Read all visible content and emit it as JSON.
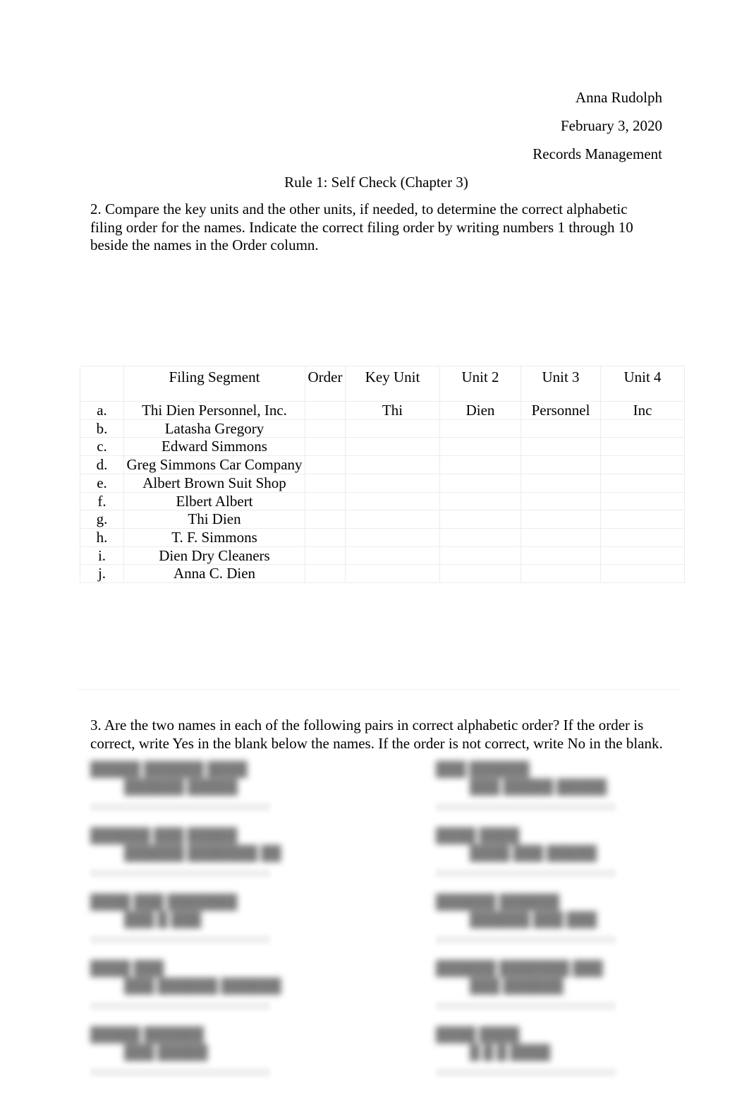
{
  "document": {
    "header_lines": [
      "Anna Rudolph",
      "February 3, 2020",
      "Records Management"
    ],
    "title": "Rule 1: Self Check (Chapter 3)",
    "question_2": "2. Compare the key units and the other units, if needed, to determine the correct alphabetic filing order for the names. Indicate the correct filing order by writing numbers 1 through 10 beside the names in the Order column.",
    "question_3": "3. Are the two names in each of the following pairs in correct alphabetic order? If the order is correct, write Yes in the blank below the names. If the order is not correct, write No in the blank."
  },
  "filing_table": {
    "headers": {
      "letter": "",
      "filing_segment": "Filing Segment",
      "order": "Order",
      "key_unit": "Key Unit",
      "unit_2": "Unit 2",
      "unit_3": "Unit 3",
      "unit_4": "Unit 4"
    },
    "rows": [
      {
        "letter": "a.",
        "filing_segment": "Thi Dien Personnel, Inc.",
        "order": "",
        "key_unit": "Thi",
        "unit_2": "Dien",
        "unit_3": "Personnel",
        "unit_4": "Inc"
      },
      {
        "letter": "b.",
        "filing_segment": "Latasha Gregory",
        "order": "",
        "key_unit": "",
        "unit_2": "",
        "unit_3": "",
        "unit_4": ""
      },
      {
        "letter": "c.",
        "filing_segment": "Edward Simmons",
        "order": "",
        "key_unit": "",
        "unit_2": "",
        "unit_3": "",
        "unit_4": ""
      },
      {
        "letter": "d.",
        "filing_segment": "Greg Simmons Car Company",
        "order": "",
        "key_unit": "",
        "unit_2": "",
        "unit_3": "",
        "unit_4": ""
      },
      {
        "letter": "e.",
        "filing_segment": "Albert Brown Suit Shop",
        "order": "",
        "key_unit": "",
        "unit_2": "",
        "unit_3": "",
        "unit_4": ""
      },
      {
        "letter": "f.",
        "filing_segment": "Elbert Albert",
        "order": "",
        "key_unit": "",
        "unit_2": "",
        "unit_3": "",
        "unit_4": ""
      },
      {
        "letter": "g.",
        "filing_segment": "Thi Dien",
        "order": "",
        "key_unit": "",
        "unit_2": "",
        "unit_3": "",
        "unit_4": ""
      },
      {
        "letter": "h.",
        "filing_segment": "T. F. Simmons",
        "order": "",
        "key_unit": "",
        "unit_2": "",
        "unit_3": "",
        "unit_4": ""
      },
      {
        "letter": "i.",
        "filing_segment": "Dien Dry Cleaners",
        "order": "",
        "key_unit": "",
        "unit_2": "",
        "unit_3": "",
        "unit_4": ""
      },
      {
        "letter": "j.",
        "filing_segment": "Anna C. Dien",
        "order": "",
        "key_unit": "",
        "unit_2": "",
        "unit_3": "",
        "unit_4": ""
      }
    ]
  },
  "obscured_section": {
    "note": "two-column list of name pairs, rendered blurred/illegible in the source image",
    "rows": [
      {
        "left": {
          "line1": "█████ ██████ ████",
          "line2": "██████ █████"
        },
        "right": {
          "line1": "███ ██████",
          "line2": "███ █████ █████"
        }
      },
      {
        "left": {
          "line1": "██████ ███ █████",
          "line2": "██████ ███████ ██"
        }
      },
      {
        "left": {
          "line1": "████ ███ ███████",
          "line2": "███ █ ███"
        },
        "right": {
          "line1": "██████ ██████",
          "line2": "██████ ███ ███"
        }
      },
      {
        "left": {
          "line1": "████ ███",
          "line2": "███ ██████ ██████"
        },
        "right": {
          "line1": "██████ ███████ ███",
          "line2": "███ ██████"
        }
      },
      {
        "left": {
          "line1": "█████ ██████",
          "line2": "███ █████"
        },
        "right": {
          "line1": "████ ████",
          "line2": "█ █ █ ████"
        }
      }
    ],
    "right_second_row": {
      "line1": "████ ████",
      "line2": "████ ███ █████"
    }
  }
}
